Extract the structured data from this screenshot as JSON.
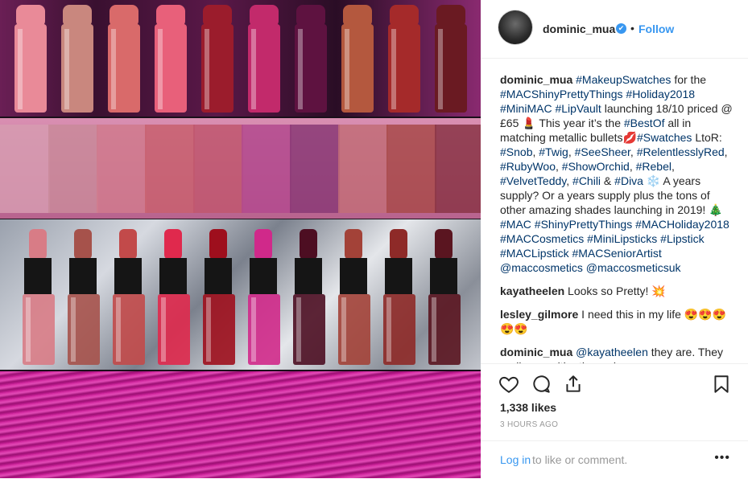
{
  "post": {
    "username": "dominic_mua",
    "follow_label": "Follow",
    "dot": "•",
    "verified_glyph": "✔"
  },
  "comments": [
    {
      "user": "dominic_mua",
      "parts": [
        {
          "t": "tag",
          "v": "#MakeupSwatches"
        },
        {
          "t": "text",
          "v": " for the "
        },
        {
          "t": "tag",
          "v": "#MACShinyPrettyThings"
        },
        {
          "t": "text",
          "v": " "
        },
        {
          "t": "tag",
          "v": "#Holiday2018"
        },
        {
          "t": "text",
          "v": " "
        },
        {
          "t": "tag",
          "v": "#MiniMAC"
        },
        {
          "t": "text",
          "v": " "
        },
        {
          "t": "tag",
          "v": "#LipVault"
        },
        {
          "t": "text",
          "v": " launching 18/10 priced @ £65 💄 This year it’s the "
        },
        {
          "t": "tag",
          "v": "#BestOf"
        },
        {
          "t": "text",
          "v": " all in matching metallic bullets💋"
        },
        {
          "t": "tag",
          "v": "#Swatches"
        },
        {
          "t": "text",
          "v": " LtoR: "
        },
        {
          "t": "tag",
          "v": "#Snob"
        },
        {
          "t": "text",
          "v": ", "
        },
        {
          "t": "tag",
          "v": "#Twig"
        },
        {
          "t": "text",
          "v": ", "
        },
        {
          "t": "tag",
          "v": "#SeeSheer"
        },
        {
          "t": "text",
          "v": ", "
        },
        {
          "t": "tag",
          "v": "#RelentlesslyRed"
        },
        {
          "t": "text",
          "v": ", "
        },
        {
          "t": "tag",
          "v": "#RubyWoo"
        },
        {
          "t": "text",
          "v": ", "
        },
        {
          "t": "tag",
          "v": "#ShowOrchid"
        },
        {
          "t": "text",
          "v": ", "
        },
        {
          "t": "tag",
          "v": "#Rebel"
        },
        {
          "t": "text",
          "v": ", "
        },
        {
          "t": "tag",
          "v": "#VelvetTeddy"
        },
        {
          "t": "text",
          "v": ", "
        },
        {
          "t": "tag",
          "v": "#Chili"
        },
        {
          "t": "text",
          "v": " & "
        },
        {
          "t": "tag",
          "v": "#Diva"
        },
        {
          "t": "text",
          "v": " ❄️ A years supply? Or a years supply plus the tons of other amazing shades launching in 2019! 🎄"
        },
        {
          "t": "tag",
          "v": "#MAC"
        },
        {
          "t": "text",
          "v": " "
        },
        {
          "t": "tag",
          "v": "#ShinyPrettyThings"
        },
        {
          "t": "text",
          "v": " "
        },
        {
          "t": "tag",
          "v": "#MACHoliday2018"
        },
        {
          "t": "text",
          "v": " "
        },
        {
          "t": "tag",
          "v": "#MACCosmetics"
        },
        {
          "t": "text",
          "v": " "
        },
        {
          "t": "tag",
          "v": "#MiniLipsticks"
        },
        {
          "t": "text",
          "v": " "
        },
        {
          "t": "tag",
          "v": "#Lipstick"
        },
        {
          "t": "text",
          "v": " "
        },
        {
          "t": "tag",
          "v": "#MACLipstick"
        },
        {
          "t": "text",
          "v": " "
        },
        {
          "t": "tag",
          "v": "#MACSeniorArtist"
        },
        {
          "t": "text",
          "v": " "
        },
        {
          "t": "tag",
          "v": "@maccosmetics"
        },
        {
          "t": "text",
          "v": " "
        },
        {
          "t": "tag",
          "v": "@maccosmeticsuk"
        }
      ]
    },
    {
      "user": "kayatheelen",
      "parts": [
        {
          "t": "text",
          "v": " Looks so Pretty! 💥"
        }
      ]
    },
    {
      "user": "lesley_gilmore",
      "parts": [
        {
          "t": "text",
          "v": " I need this in my life 😍😍😍😍😍"
        }
      ]
    },
    {
      "user": "dominic_mua",
      "parts": [
        {
          "t": "tag",
          "v": " @kayatheelen"
        },
        {
          "t": "text",
          "v": " they are. They really are with other colors"
        }
      ]
    }
  ],
  "engagement": {
    "likes": "1,338 likes",
    "time": "3 HOURS AGO"
  },
  "footer": {
    "login_label": "Log in",
    "login_rest": "to like or comment.",
    "more_glyph": "•••"
  },
  "photo": {
    "lipstick_colors_top": [
      "#e98a98",
      "#c9877e",
      "#d96a6a",
      "#e8607a",
      "#9b1c2c",
      "#c22a6b",
      "#5e1240",
      "#b4583e",
      "#a52a2a",
      "#6a1a22"
    ],
    "swatch_colors": [
      "#d69bb0",
      "#c98a9a",
      "#d07a8d",
      "#c8606e",
      "#c0576f",
      "#b34a8e",
      "#8a3a75",
      "#c26d78",
      "#a84a4a",
      "#8a3546"
    ],
    "mini_colors": [
      "#d87c86",
      "#a6524b",
      "#c24a4a",
      "#e0294d",
      "#9e0f1d",
      "#d0298a",
      "#4d0e22",
      "#a34238",
      "#8e2a28",
      "#5a1520"
    ]
  }
}
